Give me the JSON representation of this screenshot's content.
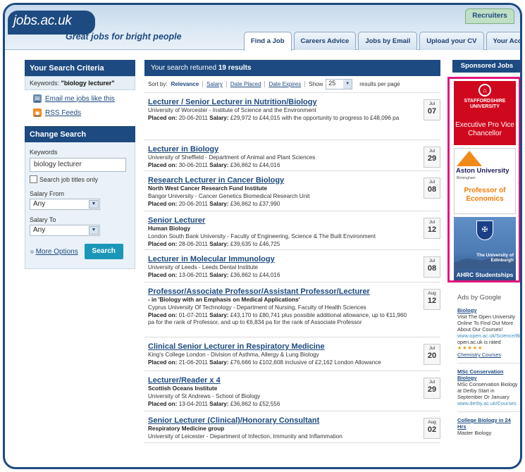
{
  "header": {
    "logo_text": "jobs.ac.uk",
    "tagline": "Great jobs for bright people",
    "recruiters_label": "Recruiters",
    "tabs": [
      {
        "label": "Find a Job"
      },
      {
        "label": "Careers Advice"
      },
      {
        "label": "Jobs by Email"
      },
      {
        "label": "Upload your CV"
      },
      {
        "label": "Your Account"
      }
    ]
  },
  "criteria": {
    "title": "Your Search Criteria",
    "keywords_label": "Keywords:",
    "keywords_value": "\"biology lecturer\"",
    "email_link": "Email me jobs like this",
    "rss_link": "RSS Feeds"
  },
  "change_search": {
    "title": "Change Search",
    "keywords_label": "Keywords",
    "keywords_value": "biology lecturer",
    "titles_only_label": "Search job titles only",
    "salary_from_label": "Salary From",
    "salary_from_value": "Any",
    "salary_to_label": "Salary To",
    "salary_to_value": "Any",
    "more_options": "More Options",
    "search_button": "Search"
  },
  "results": {
    "prefix": "Your search returned ",
    "count": "19 results",
    "sort_by": "Sort by:",
    "sort_relevance": "Relevance",
    "sort_salary": "Salary",
    "sort_date_placed": "Date Placed",
    "sort_date_expires": "Date Expires",
    "show_label": "Show",
    "per_page_value": "25",
    "per_page_suffix": "results per page",
    "jobs": [
      {
        "title": "Lecturer / Senior Lecturer in Nutrition/Biology",
        "org": "",
        "dept": "University of Worcester - Institute of Science and the Environment",
        "placed": "20-06-2011",
        "salary": "£29,972 to £44,015 with the opportunity to progress to £48,096 pa",
        "month": "Jul",
        "day": "07"
      },
      {
        "title": "Lecturer in Biology",
        "org": "",
        "dept": "University of Sheffield - Department of Animal and Plant Sciences",
        "placed": "30-06-2011",
        "salary": "£36,862 to £44,016",
        "month": "Jul",
        "day": "29"
      },
      {
        "title": "Research Lecturer in Cancer Biology",
        "org": "North West Cancer Research Fund Institute",
        "dept": "Bangor University - Cancer Genetics Biomedical Research Unit",
        "placed": "20-06-2011",
        "salary": "£36,862 to £37,990",
        "month": "Jul",
        "day": "08"
      },
      {
        "title": "Senior Lecturer",
        "org": "Human Biology",
        "dept": "London South Bank University - Faculty of Engineering, Science & The Built Environment",
        "placed": "28-06-2011",
        "salary": "£39,635 to £46,725",
        "month": "Jul",
        "day": "12"
      },
      {
        "title": "Lecturer in Molecular Immunology",
        "org": "",
        "dept": "University of Leeds - Leeds Dental Institute",
        "placed": "13-06-2011",
        "salary": "£36,862 to £44,016",
        "month": "Jul",
        "day": "08"
      },
      {
        "title": "Professor/Associate Professor/Assistant Professor/Lecturer",
        "org": "- in 'Biology with an Emphasis on Medical Applications'",
        "dept": "Cyprus University Of Technology - Department of Nursing, Faculty of Health Sciences",
        "placed": "01-07-2011",
        "salary": "£43,170 to £80,741 plus possible additional allowance, up to €11,960 pa for the rank of Professor, and up to €6,834 pa for the rank of Associate Professor",
        "month": "Aug",
        "day": "12"
      },
      {
        "title": "Clinical Senior Lecturer in Respiratory Medicine",
        "org": "",
        "dept": "King's College London - Division of Asthma, Allergy & Lung Biology",
        "placed": "21-06-2011",
        "salary": "£76,666 to £102,608 inclusive of £2,162 London Allowance",
        "month": "Jul",
        "day": "20"
      },
      {
        "title": "Lecturer/Reader x 4",
        "org": "Scottish Oceans Institute",
        "dept": "University of St Andrews - School of Biology",
        "placed": "13-04-2011",
        "salary": "£36,862 to £52,556",
        "month": "Jul",
        "day": "29"
      },
      {
        "title": "Senior Lecturer (Clinical)/Honorary Consultant",
        "org": "Respiratory Medicine group",
        "dept": "University of Leicester - Department of Infection, Immunity and Inflammation",
        "placed": "",
        "salary": "",
        "month": "Aug",
        "day": "02"
      }
    ],
    "placed_label": "Placed on:",
    "salary_label": "Salary:"
  },
  "sidebar": {
    "sponsored_title": "Sponsored Jobs",
    "ad1": {
      "university": "STAFFORDSHIRE UNIVERSITY",
      "role": "Executive Pro Vice Chancellor"
    },
    "ad2": {
      "university": "Aston University",
      "city": "Birmingham",
      "role": "Professor of Economics"
    },
    "ad3": {
      "university": "The University of Edinburgh",
      "role": "AHRC Studentships"
    },
    "google_title": "Ads by Google",
    "google_ads": [
      {
        "title": "Biology",
        "text": "Visit The Open University Online To Find Out More About Our Courses!",
        "url": "www.open.ac.uk/Science/Biology",
        "rated": "open.ac.uk is rated",
        "course": "Chemistry Courses"
      },
      {
        "title": "MSc Conservation Biology",
        "text": "MSc Conservation Biology at Derby Start in September Or January",
        "url": "www.derby.ac.uk/Courses"
      },
      {
        "title": "College Biology in 24 Hrs",
        "text": "Master Biology"
      }
    ]
  },
  "colors": {
    "brand": "#1d4a80",
    "accent": "#1a97b8",
    "ad_border": "#e2157c"
  },
  "icons": {
    "email": "email-icon",
    "rss": "rss-icon",
    "select": "chevron-down-icon"
  }
}
